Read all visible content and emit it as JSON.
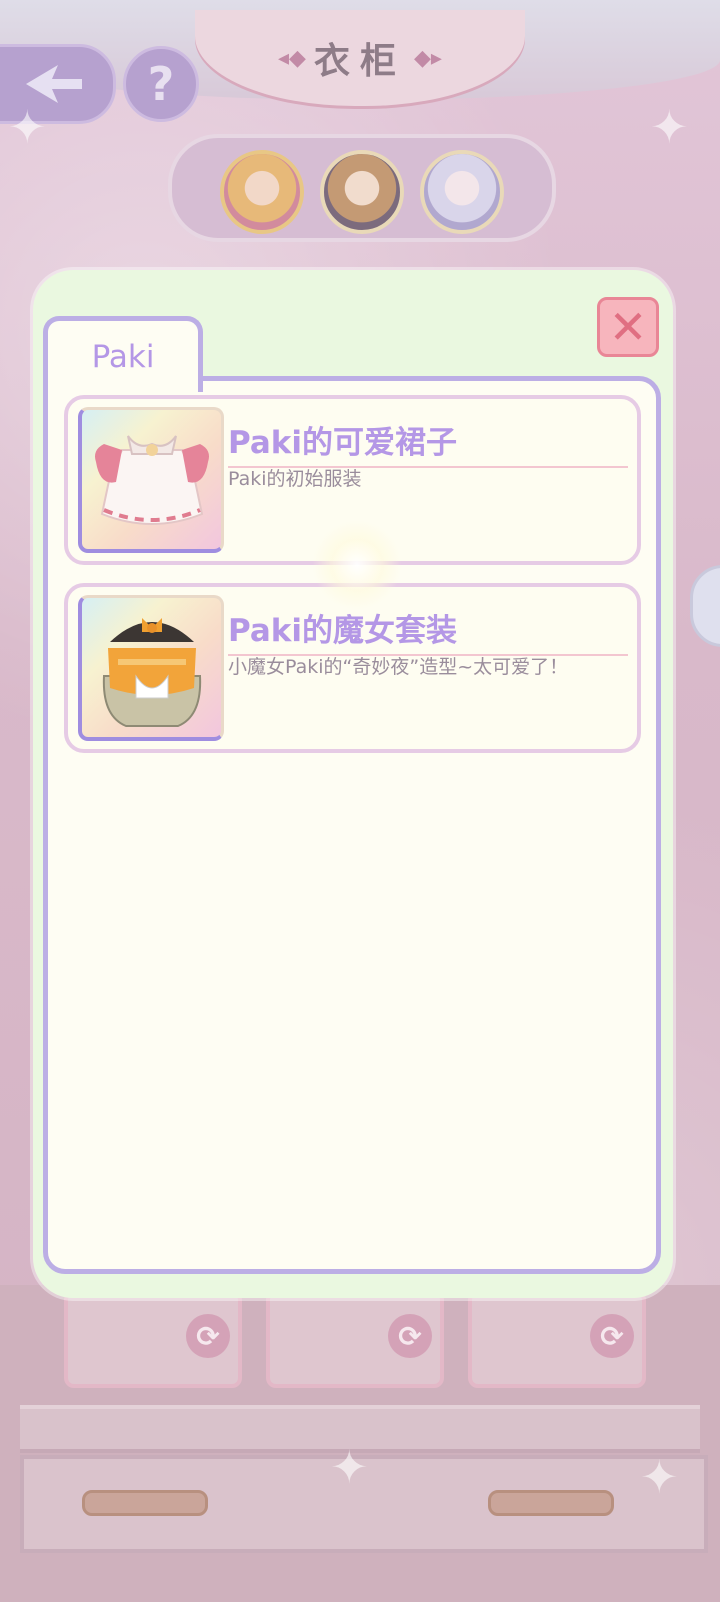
{
  "header": {
    "title": "衣柜",
    "back_icon": "back-arrow-icon",
    "help_label": "?"
  },
  "characters": [
    {
      "name": "character-avatar-1",
      "selected": true
    },
    {
      "name": "character-avatar-2",
      "selected": false
    },
    {
      "name": "character-avatar-3",
      "selected": false
    }
  ],
  "popup": {
    "close_label": "✕",
    "tab_label": "Paki",
    "items": [
      {
        "name": "Paki的可爱裙子",
        "description": "Paki的初始服装",
        "icon": "pink-dress-icon"
      },
      {
        "name": "Paki的魔女套装",
        "description": "小魔女Paki的“奇妙夜”造型~太可爱了！",
        "icon": "witch-costume-icon"
      }
    ]
  },
  "colors": {
    "accent_purple": "#b497e6",
    "panel_border": "#bcaee5",
    "close_red": "#e06f82",
    "popup_bg": "#eaf8e0"
  }
}
